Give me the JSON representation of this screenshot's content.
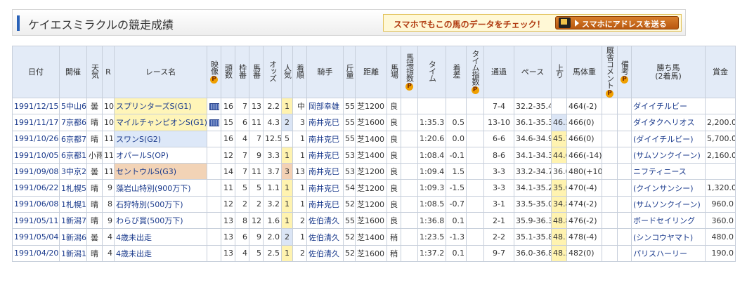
{
  "page_title": "ケイエスミラクルの競走成績",
  "promo": {
    "text": "スマホでもこの馬のデータをチェック！",
    "button": "スマホにアドレスを送る"
  },
  "p_badge": "P",
  "headers": {
    "date": "日付",
    "venue": "開催",
    "weather": "天気",
    "race_no": "R",
    "race_name": "レース名",
    "video": "映像",
    "field": "頭数",
    "frame": "枠番",
    "horse_no": "馬番",
    "odds": "オッズ",
    "popularity": "人気",
    "finish": "着順",
    "jockey": "騎手",
    "weight": "斤量",
    "distance": "距離",
    "track": "馬場",
    "track_index": "馬場指数",
    "time": "タイム",
    "margin": "着差",
    "time_index": "タイム指数",
    "passing": "通過",
    "pace": "ペース",
    "last3f": "上り",
    "body_weight": "馬体重",
    "comment": "厩舎コメント",
    "remarks": "備考",
    "winner": "勝ち馬\n(2着馬)",
    "prize": "賞金"
  },
  "rows": [
    {
      "date": "1991/12/15",
      "venue": "5中山6",
      "weather": "曇",
      "race_no": "10",
      "race_name": "スプリンターズS(G1)",
      "grade": "g1",
      "video": true,
      "field": "16",
      "frame": "7",
      "horse_no": "13",
      "odds": "2.2",
      "popularity": "1",
      "finish": "中",
      "jockey": "岡部幸雄",
      "weight": "55",
      "distance": "芝1200",
      "track": "良",
      "time": "",
      "margin": "",
      "passing": "7-4",
      "pace": "32.2-35.4",
      "last3f": "",
      "body_weight": "464(-2)",
      "winner": "ダイイチルビー",
      "prize": ""
    },
    {
      "date": "1991/11/17",
      "venue": "7京都6",
      "weather": "晴",
      "race_no": "10",
      "race_name": "マイルチャンピオンS(G1)",
      "grade": "g1",
      "video": true,
      "field": "15",
      "frame": "6",
      "horse_no": "11",
      "odds": "4.3",
      "popularity": "2",
      "finish": "3",
      "jockey": "南井克巳",
      "weight": "55",
      "distance": "芝1600",
      "track": "良",
      "time": "1:35.3",
      "margin": "0.5",
      "passing": "13-10",
      "pace": "36.1-35.3",
      "last3f": "46.3",
      "body_weight": "466(0)",
      "winner": "ダイタクヘリオス",
      "prize": "2,200.0"
    },
    {
      "date": "1991/10/26",
      "venue": "6京都7",
      "weather": "晴",
      "race_no": "11",
      "race_name": "スワンS(G2)",
      "grade": "g2",
      "video": false,
      "field": "16",
      "frame": "4",
      "horse_no": "7",
      "odds": "12.5",
      "popularity": "5",
      "finish": "1",
      "jockey": "南井克巳",
      "weight": "55",
      "distance": "芝1400",
      "track": "良",
      "time": "1:20.6",
      "margin": "0.0",
      "passing": "6-6",
      "pace": "34.6-34.9",
      "last3f": "45.7",
      "body_weight": "466(0)",
      "winner": "(ダイイチルビー)",
      "prize": "5,700.0"
    },
    {
      "date": "1991/10/05",
      "venue": "6京都1",
      "weather": "小雨",
      "race_no": "11",
      "race_name": "オパールS(OP)",
      "grade": "",
      "video": false,
      "field": "12",
      "frame": "7",
      "horse_no": "9",
      "odds": "3.3",
      "popularity": "1",
      "finish": "1",
      "jockey": "南井克巳",
      "weight": "53",
      "distance": "芝1400",
      "track": "良",
      "time": "1:08.4",
      "margin": "-0.1",
      "passing": "8-6",
      "pace": "34.1-34.3",
      "last3f": "44.6",
      "body_weight": "466(-14)",
      "winner": "(サムソンクイーン)",
      "prize": "2,160.0"
    },
    {
      "date": "1991/09/08",
      "venue": "3中京2",
      "weather": "曇",
      "race_no": "11",
      "race_name": "セントウルS(G3)",
      "grade": "g3",
      "video": false,
      "field": "14",
      "frame": "7",
      "horse_no": "11",
      "odds": "3.7",
      "popularity": "3",
      "finish": "13",
      "jockey": "南井克巳",
      "weight": "53",
      "distance": "芝1200",
      "track": "良",
      "time": "1:09.4",
      "margin": "1.5",
      "passing": "3-3",
      "pace": "33.2-34.7",
      "last3f": "36.0",
      "body_weight": "480(+10)",
      "winner": "ニフティニース",
      "prize": ""
    },
    {
      "date": "1991/06/22",
      "venue": "1札幌5",
      "weather": "晴",
      "race_no": "9",
      "race_name": "藻岩山特別(900万下)",
      "grade": "",
      "video": false,
      "field": "11",
      "frame": "5",
      "horse_no": "5",
      "odds": "1.1",
      "popularity": "1",
      "finish": "1",
      "jockey": "南井克巳",
      "weight": "54",
      "distance": "芝1200",
      "track": "良",
      "time": "1:09.3",
      "margin": "-1.5",
      "passing": "3-3",
      "pace": "34.1-35.2",
      "last3f": "35.0",
      "body_weight": "470(-4)",
      "winner": "(クインサンシー)",
      "prize": "1,320.0"
    },
    {
      "date": "1991/06/08",
      "venue": "1札幌1",
      "weather": "晴",
      "race_no": "8",
      "race_name": "石狩特別(500万下)",
      "grade": "",
      "video": false,
      "field": "12",
      "frame": "2",
      "horse_no": "2",
      "odds": "3.2",
      "popularity": "1",
      "finish": "1",
      "jockey": "南井克巳",
      "weight": "52",
      "distance": "芝1200",
      "track": "良",
      "time": "1:08.5",
      "margin": "-0.7",
      "passing": "3-1",
      "pace": "33.5-35.0",
      "last3f": "34.8",
      "body_weight": "474(-2)",
      "winner": "(サムソンクイーン)",
      "prize": "960.0"
    },
    {
      "date": "1991/05/11",
      "venue": "1新潟7",
      "weather": "晴",
      "race_no": "9",
      "race_name": "わらび賞(500万下)",
      "grade": "",
      "video": false,
      "field": "13",
      "frame": "8",
      "horse_no": "12",
      "odds": "1.6",
      "popularity": "1",
      "finish": "2",
      "jockey": "佐伯清久",
      "weight": "55",
      "distance": "芝1600",
      "track": "良",
      "time": "1:36.8",
      "margin": "0.1",
      "passing": "2-1",
      "pace": "35.9-36.3",
      "last3f": "48.8",
      "body_weight": "476(-2)",
      "winner": "ボードセイリング",
      "prize": "360.0"
    },
    {
      "date": "1991/05/04",
      "venue": "1新潟6",
      "weather": "曇",
      "race_no": "4",
      "race_name": "4歳未出走",
      "grade": "",
      "video": false,
      "field": "13",
      "frame": "6",
      "horse_no": "9",
      "odds": "2.0",
      "popularity": "2",
      "finish": "1",
      "jockey": "佐伯清久",
      "weight": "52",
      "distance": "芝1400",
      "track": "稍",
      "time": "1:23.5",
      "margin": "-1.3",
      "passing": "2-2",
      "pace": "35.1-35.8",
      "last3f": "48.1",
      "body_weight": "478(-4)",
      "winner": "(シンコウヤマト)",
      "prize": "480.0"
    },
    {
      "date": "1991/04/20",
      "venue": "1新潟1",
      "weather": "晴",
      "race_no": "4",
      "race_name": "4歳未出走",
      "grade": "",
      "video": false,
      "field": "13",
      "frame": "4",
      "horse_no": "5",
      "odds": "2.5",
      "popularity": "1",
      "finish": "2",
      "jockey": "佐伯清久",
      "weight": "52",
      "distance": "芝1600",
      "track": "稍",
      "time": "1:37.2",
      "margin": "0.1",
      "passing": "9-7",
      "pace": "36.0-36.8",
      "last3f": "48.3",
      "body_weight": "482(0)",
      "winner": "パリスハーリー",
      "prize": "190.0"
    }
  ]
}
